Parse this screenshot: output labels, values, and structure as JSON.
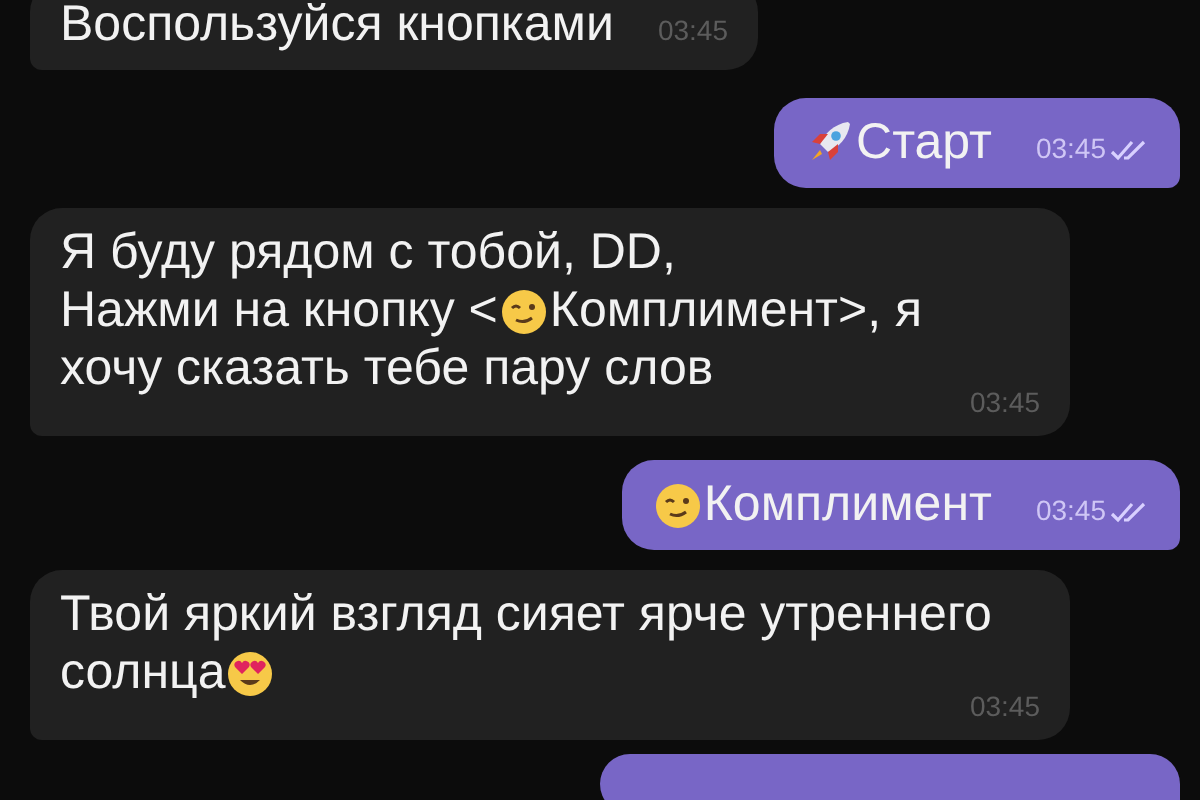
{
  "messages": [
    {
      "kind": "incoming",
      "parts": [
        {
          "kind": "text",
          "text": "Воспользуйся кнопками"
        }
      ],
      "time": "03:45"
    },
    {
      "kind": "outgoing",
      "parts": [
        {
          "kind": "emoji"
        },
        {
          "kind": "text",
          "text": "Старт"
        }
      ],
      "time": "03:45",
      "read": true
    },
    {
      "kind": "incoming",
      "parts": [
        {
          "kind": "text",
          "text": "Я буду рядом с тобой, DD,\nНажми на кнопку <"
        },
        {
          "kind": "emoji"
        },
        {
          "kind": "text",
          "text": "Комплимент>, я\nхочу сказать тебе пару слов"
        }
      ],
      "time": "03:45"
    },
    {
      "kind": "outgoing",
      "parts": [
        {
          "kind": "emoji"
        },
        {
          "kind": "text",
          "text": "Комплимент"
        }
      ],
      "time": "03:45",
      "read": true
    },
    {
      "kind": "incoming",
      "parts": [
        {
          "kind": "text",
          "text": "Твой яркий взгляд сияет ярче утреннего\nсолнца"
        },
        {
          "kind": "emoji"
        }
      ],
      "time": "03:45"
    },
    {
      "kind": "outgoing"
    }
  ]
}
